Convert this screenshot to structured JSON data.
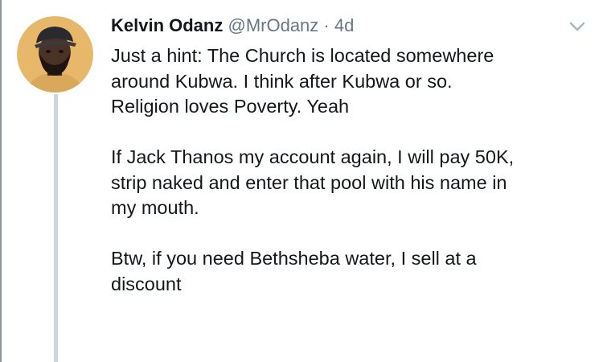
{
  "tweet": {
    "author_name": "Kelvin Odanz",
    "handle": "@MrOdanz",
    "separator": "·",
    "time_ago": "4d",
    "icons": {
      "avatar": "user-avatar",
      "menu": "chevron-down-icon"
    },
    "paragraphs": [
      "Just  a hint: The Church is located somewhere\naround Kubwa. I think after Kubwa or so.\nReligion loves Poverty. Yeah",
      "If Jack Thanos my account again, I will pay 50K,\nstrip naked and enter that pool with his name in\nmy mouth.",
      "Btw, if you need Bethsheba water, I sell at a\ndiscount"
    ]
  },
  "colors": {
    "text": "#14171a",
    "muted": "#657786",
    "thread_line": "#ccd6dd",
    "avatar_bg": "#e8b86a"
  }
}
